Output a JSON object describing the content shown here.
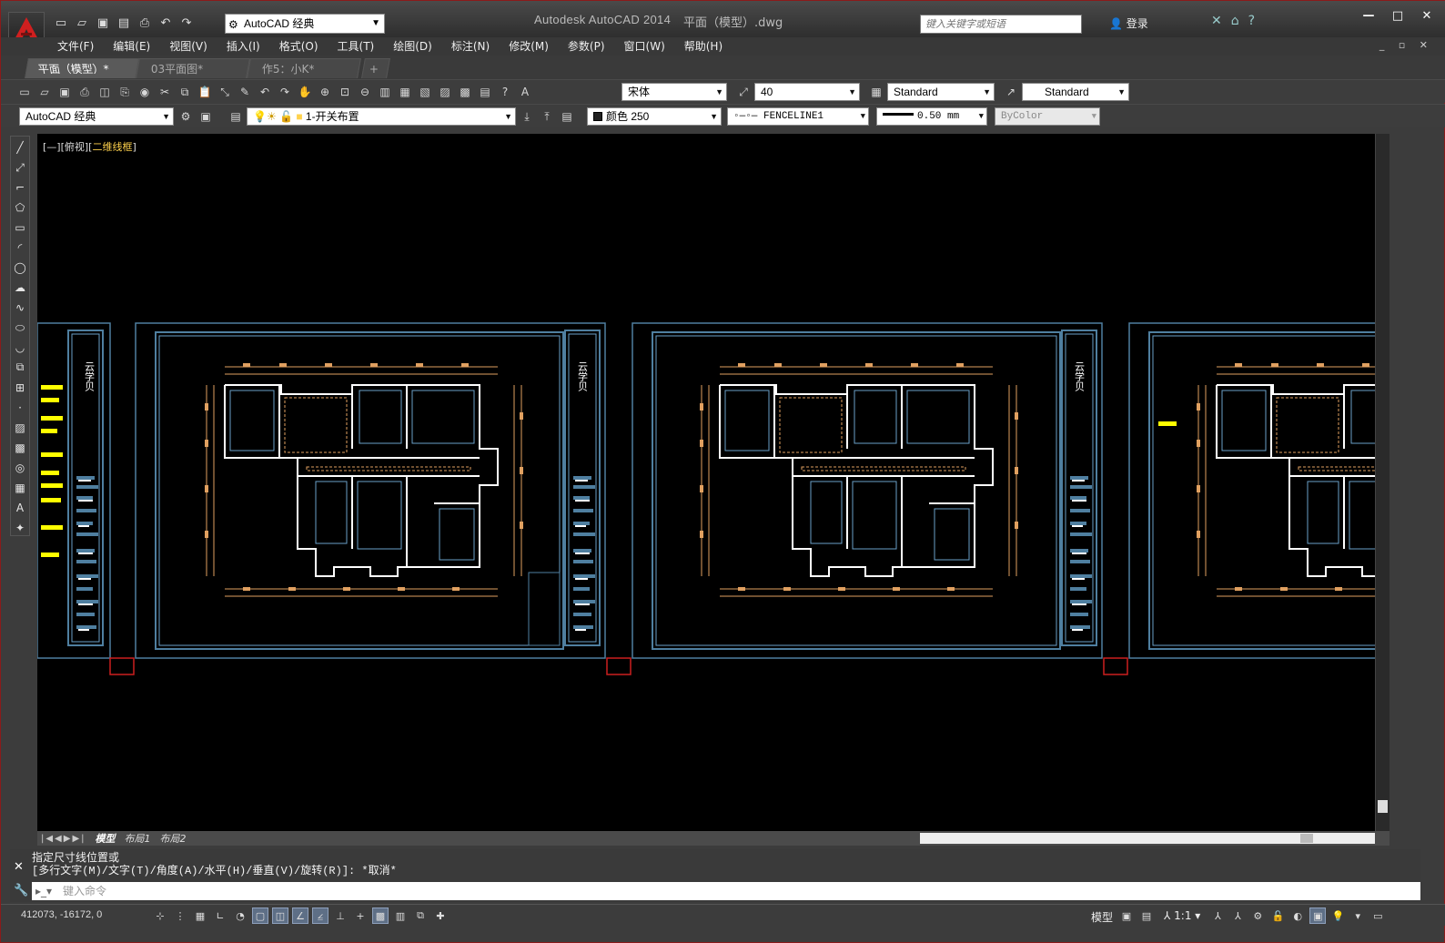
{
  "title": {
    "app": "Autodesk AutoCAD 2014",
    "file": "平面（模型）.dwg"
  },
  "workspace": "AutoCAD 经典",
  "search": {
    "placeholder": "键入关键字或短语"
  },
  "login": "登录",
  "menu": [
    "文件(F)",
    "编辑(E)",
    "视图(V)",
    "插入(I)",
    "格式(O)",
    "工具(T)",
    "绘图(D)",
    "标注(N)",
    "修改(M)",
    "参数(P)",
    "窗口(W)",
    "帮助(H)"
  ],
  "tabs": [
    {
      "label": "平面（模型）*",
      "active": true
    },
    {
      "label": "03平面图*",
      "active": false
    },
    {
      "label": "作5：小K*",
      "active": false
    }
  ],
  "styles": {
    "text_font": "宋体",
    "text_height": "40",
    "dim_style": "Standard",
    "multileader_style": "Standard"
  },
  "layers": {
    "workspace": "AutoCAD 经典",
    "current_layer": "1-开关布置",
    "color": "颜色 250",
    "linetype": "FENCELINE1",
    "lineweight": "0.50 mm",
    "plotstyle": "ByColor"
  },
  "viewport_label": {
    "prefix": "[—][俯视][",
    "mode": "二维线框",
    "suffix": "]"
  },
  "sheets": {
    "title_block_text": "云学贝"
  },
  "layout_tabs": [
    "模型",
    "布局1",
    "布局2"
  ],
  "command": {
    "history": [
      "指定尺寸线位置或",
      "[多行文字(M)/文字(T)/角度(A)/水平(H)/垂直(V)/旋转(R)]: *取消*"
    ],
    "placeholder": "键入命令"
  },
  "status": {
    "coords": "412073, -16172, 0",
    "model": "模型",
    "annotation_scale": "1:1"
  },
  "colors": {
    "canvas": "#000000",
    "accent": "#d22222",
    "frame": "#4f7fa0",
    "dim": "#e0a060",
    "wall": "#ffffff"
  }
}
